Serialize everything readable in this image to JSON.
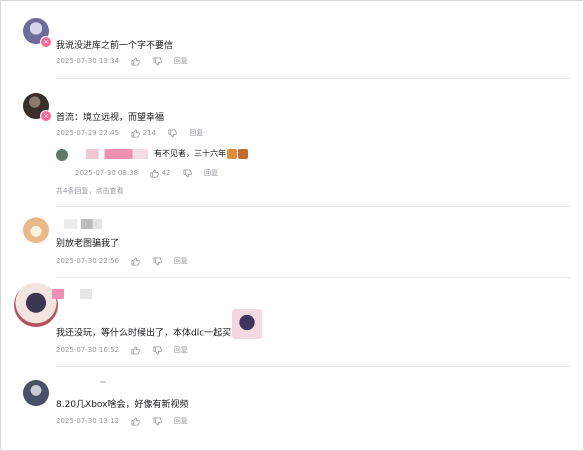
{
  "comments": [
    {
      "text": "我说没进库之前一个字不要信",
      "time": "2025-07-30 13:34",
      "likes": "",
      "reply_label": "回复",
      "avatar_color": "#6e6a9a",
      "badge": "x"
    },
    {
      "text": "首流：境立远视，而望幸福",
      "time": "2025-07-29 22:45",
      "likes": "214",
      "reply_label": "回复",
      "avatar_color": "#3a2e2a",
      "badge": "x",
      "sub_reply": {
        "text": "有不见者，三十六年",
        "time": "2025-07-30 08:38",
        "likes": "42",
        "reply_label": "回复"
      },
      "more_text": "共4条回复，",
      "more_link": "点击查看"
    },
    {
      "text": "别放老图骗我了",
      "time": "2025-07-30 22:56",
      "likes": "",
      "reply_label": "回复",
      "avatar_color": "#e8b98a"
    },
    {
      "text": "我还没玩，等什么时候出了，本体dlc一起买",
      "time": "2025-07-30 16:52",
      "likes": "",
      "reply_label": "回复",
      "avatar_color": "#b5545a"
    },
    {
      "text": "8.20几Xbox啥会，好像有新视频",
      "time": "2025-07-30 13:12",
      "likes": "",
      "reply_label": "回复",
      "avatar_color": "#4a5066"
    }
  ],
  "colors": {
    "meta": "#9499a0",
    "badge": "#ff6699",
    "separator": "#e6e7e9"
  }
}
